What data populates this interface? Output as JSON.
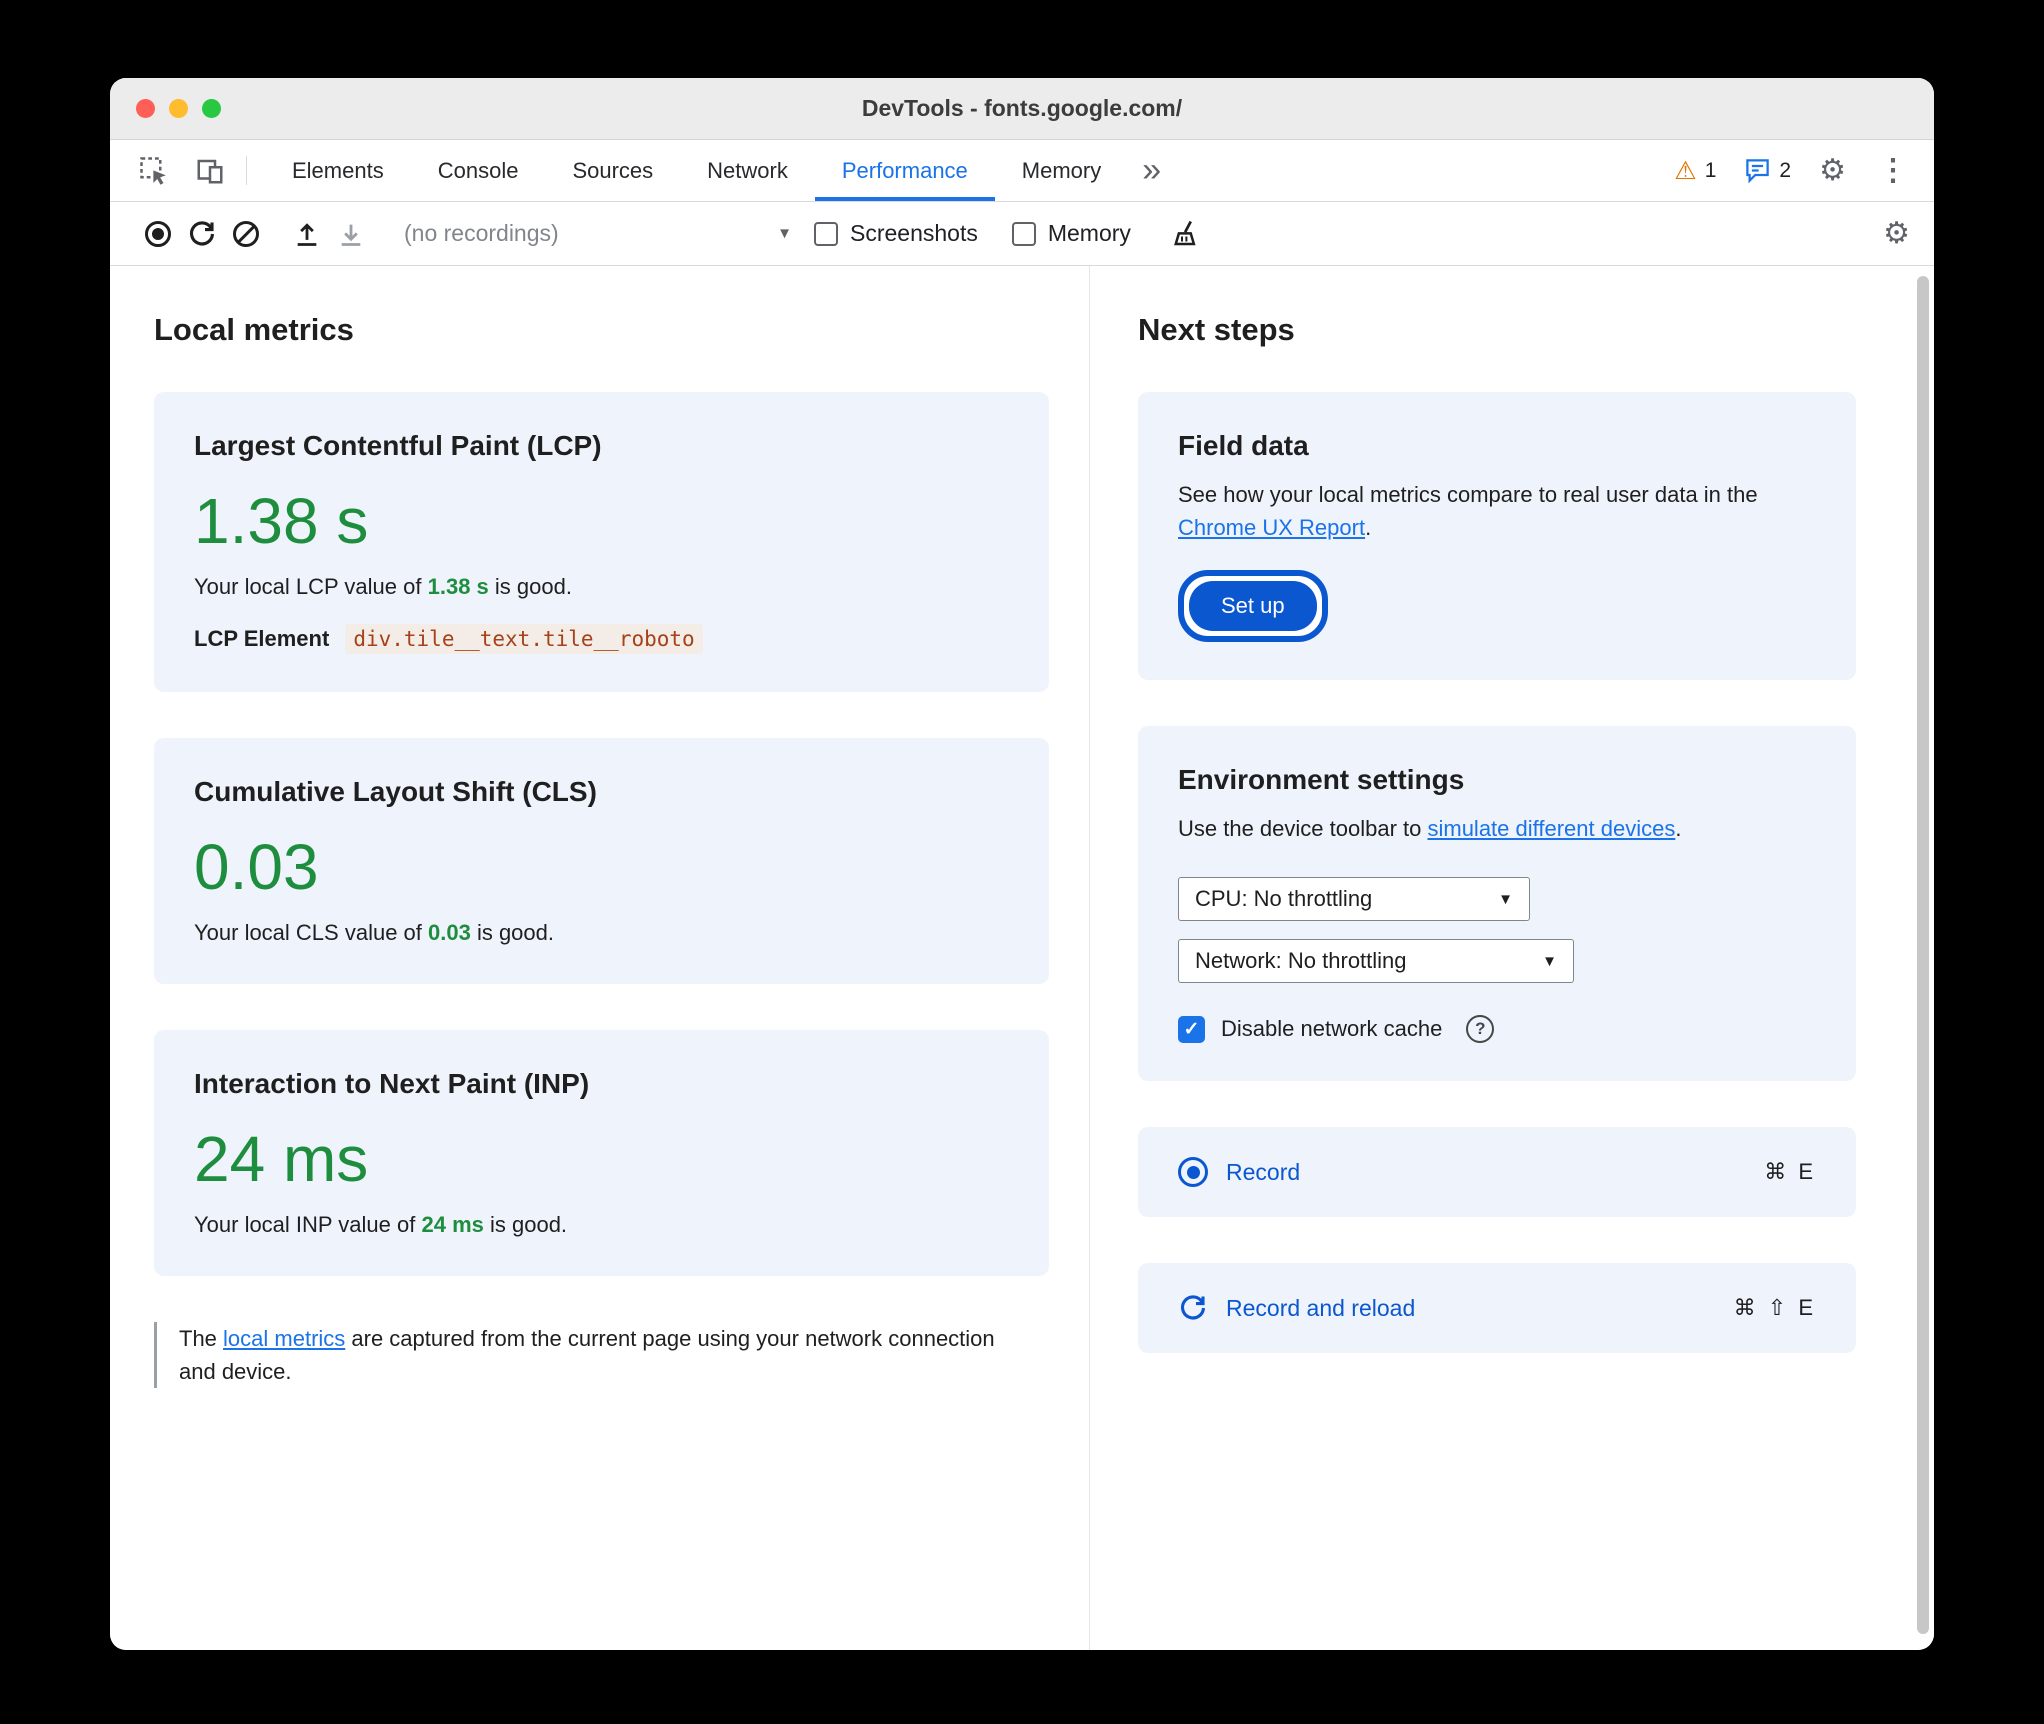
{
  "window": {
    "title": "DevTools - fonts.google.com/"
  },
  "tabs": {
    "items": [
      "Elements",
      "Console",
      "Sources",
      "Network",
      "Performance",
      "Memory"
    ],
    "active": "Performance",
    "warning_count": "1",
    "issues_count": "2"
  },
  "toolbar": {
    "recordings_label": "(no recordings)",
    "screenshots_label": "Screenshots",
    "memory_label": "Memory"
  },
  "local_metrics": {
    "heading": "Local metrics",
    "cards": [
      {
        "title": "Largest Contentful Paint (LCP)",
        "value": "1.38 s",
        "desc_prefix": "Your local LCP value of ",
        "desc_value": "1.38 s",
        "desc_suffix": " is good.",
        "element_label": "LCP Element",
        "element_code": "div.tile__text.tile__roboto"
      },
      {
        "title": "Cumulative Layout Shift (CLS)",
        "value": "0.03",
        "desc_prefix": "Your local CLS value of ",
        "desc_value": "0.03",
        "desc_suffix": " is good."
      },
      {
        "title": "Interaction to Next Paint (INP)",
        "value": "24 ms",
        "desc_prefix": "Your local INP value of ",
        "desc_value": "24 ms",
        "desc_suffix": " is good."
      }
    ],
    "footnote_prefix": "The ",
    "footnote_link": "local metrics",
    "footnote_suffix": " are captured from the current page using your network connection and device."
  },
  "next_steps": {
    "heading": "Next steps",
    "field_data": {
      "title": "Field data",
      "text_prefix": "See how your local metrics compare to real user data in the ",
      "link": "Chrome UX Report",
      "text_suffix": ".",
      "button": "Set up"
    },
    "environment": {
      "title": "Environment settings",
      "text_prefix": "Use the device toolbar to ",
      "link": "simulate different devices",
      "text_suffix": ".",
      "cpu_select": "CPU: No throttling",
      "network_select": "Network: No throttling",
      "cache_label": "Disable network cache"
    },
    "record": {
      "label": "Record",
      "shortcut": "⌘ E"
    },
    "record_reload": {
      "label": "Record and reload",
      "shortcut": "⌘ ⇧ E"
    }
  },
  "icons": {
    "more_tabs": "»",
    "warning": "⚠",
    "gear": "⚙",
    "kebab": "⋮",
    "triangle_down": "▼",
    "check": "✓",
    "question": "?"
  },
  "colors": {
    "accent_blue": "#0b57d0",
    "link_blue": "#1a73e8",
    "good_green": "#1e8e3e",
    "warning_orange": "#e37400",
    "card_background": "#eef3fc",
    "code_text": "#a64118"
  }
}
